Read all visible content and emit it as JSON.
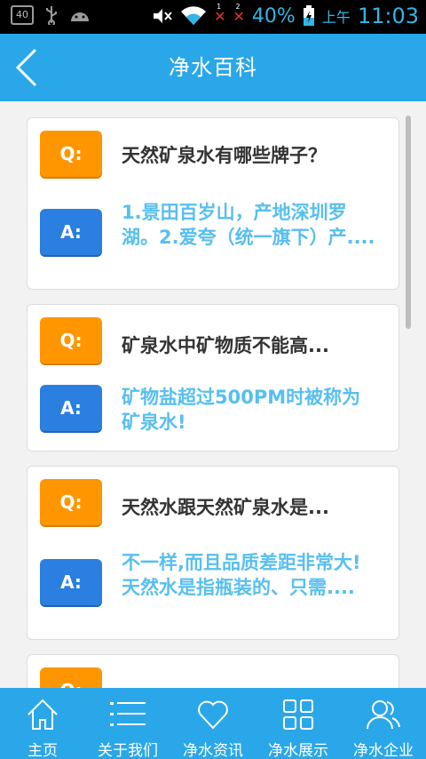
{
  "status_bar": {
    "notification_badge": "40",
    "sim1_label": "1",
    "sim2_label": "2",
    "battery_percent": "40%",
    "ampm": "上午",
    "time": "11:03"
  },
  "header": {
    "title": "净水百科",
    "back_icon": "chevron-left-icon"
  },
  "faq": [
    {
      "q_label": "Q:",
      "a_label": "A:",
      "question": "天然矿泉水有哪些牌子？",
      "answer": "1.景田百岁山，产地深圳罗湖。2.爱夸（统一旗下）产...."
    },
    {
      "q_label": "Q:",
      "a_label": "A:",
      "question": "矿泉水中矿物质不能高...",
      "answer": "矿物盐超过500PM时被称为矿泉水!"
    },
    {
      "q_label": "Q:",
      "a_label": "A:",
      "question": "天然水跟天然矿泉水是...",
      "answer": "不一样,而且品质差距非常大! 天然水是指瓶装的、只需...."
    },
    {
      "q_label": "Q:"
    }
  ],
  "tabs": [
    {
      "label": "主页",
      "icon": "home-icon"
    },
    {
      "label": "关于我们",
      "icon": "list-icon"
    },
    {
      "label": "净水资讯",
      "icon": "heart-icon"
    },
    {
      "label": "净水展示",
      "icon": "grid-icon"
    },
    {
      "label": "净水企业",
      "icon": "users-icon"
    }
  ],
  "colors": {
    "primary": "#2aa7e9",
    "question_badge": "#ff9600",
    "answer_badge": "#2a7fe0",
    "answer_text": "#57bff0"
  }
}
